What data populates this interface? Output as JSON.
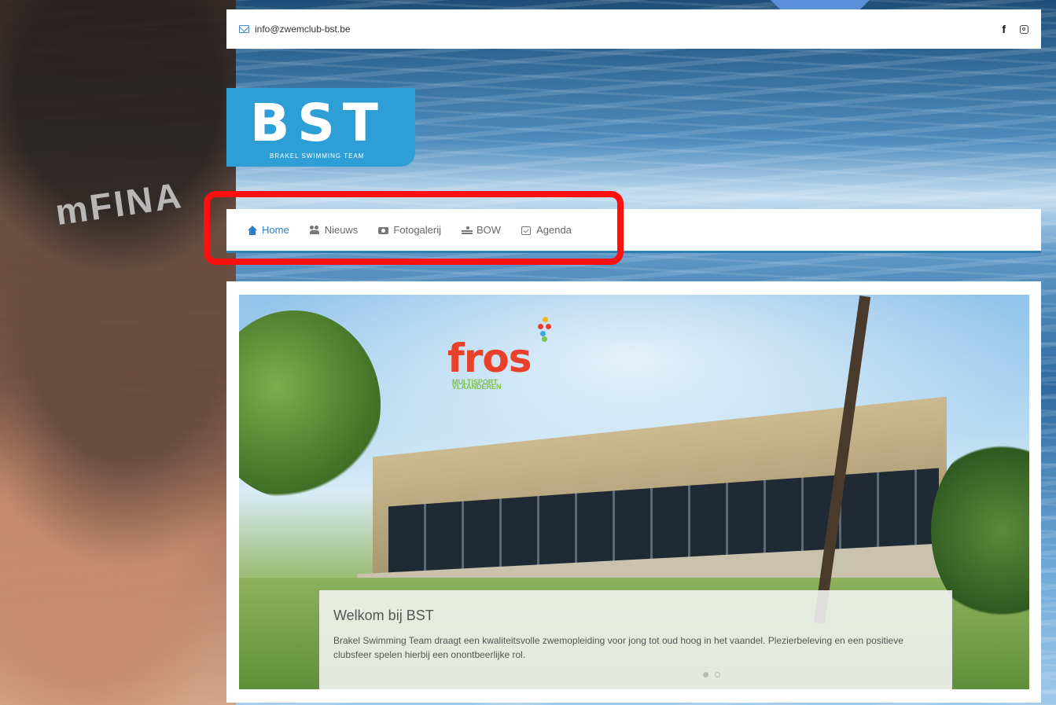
{
  "contact": {
    "email": "info@zwemclub-bst.be"
  },
  "socials": [
    "facebook-icon",
    "instagram-icon"
  ],
  "logo": {
    "text": "BST",
    "subtitle": "BRAKEL SWIMMING TEAM"
  },
  "background": {
    "cap_text": "mFINA"
  },
  "nav": {
    "items": [
      {
        "label": "Home",
        "icon": "home-icon",
        "active": true
      },
      {
        "label": "Nieuws",
        "icon": "users-icon"
      },
      {
        "label": "Fotogalerij",
        "icon": "camera-icon"
      },
      {
        "label": "BOW",
        "icon": "swimmer-icon"
      },
      {
        "label": "Agenda",
        "icon": "calendar-check-icon"
      }
    ]
  },
  "slider": {
    "sponsor": {
      "name": "fros",
      "tagline_line1": "MULTISPORT",
      "tagline_line2": "VLAANDEREN"
    },
    "caption": {
      "title": "Welkom bij BST",
      "text": "Brakel Swimming Team draagt een kwaliteitsvolle zwemopleiding voor jong tot oud hoog in het vaandel. Plezierbeleving en een positieve clubsfeer spelen hierbij een onontbeerlijke rol."
    },
    "active_slide": 1,
    "slide_count": 2
  },
  "colors": {
    "accent": "#2e7fc4",
    "logo_bg": "#2e9fd6",
    "highlight": "#ff1010",
    "arrow": "#5c8fd9",
    "fros_red": "#e8402a",
    "fros_green": "#7fc14a"
  }
}
